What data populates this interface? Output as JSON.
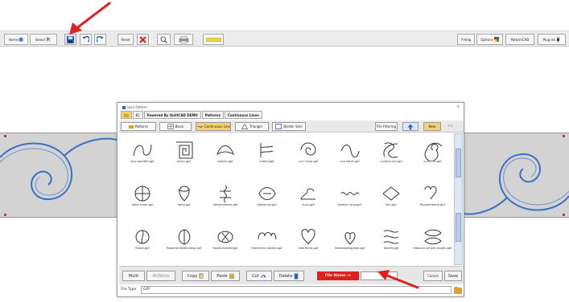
{
  "toolbar": {
    "home_label": "Home",
    "select_label": "Select",
    "reset_label": "Reset",
    "help_label": "Help",
    "options_label": "Options",
    "patterncad_label": "PatternCAD",
    "plugins_label": "Plug-ins"
  },
  "dialog": {
    "title": "Save Pattern",
    "close": "x",
    "crumbs": [
      "C:",
      "Powered By QuiltCAD DEMO",
      "Patterns",
      "Continuous Lines"
    ],
    "tabs": {
      "patterns": "Patterns",
      "block": "Block",
      "continuous_line": "Continuous Line",
      "triangle": "Triangle",
      "border_sets": "Border Sets"
    },
    "filter_label": "File Filtering",
    "new_label": "New",
    "up_label": "Up",
    "help_glyph": "<>",
    "files": [
      "arcs boarder.gpf",
      "aztec.gpf",
      "beanie.gpf",
      "cattail.gpf",
      "curl circle.gpf",
      "curl wave.gpf",
      "curleycurcs.gpf",
      "curlycue.gpf",
      "daisy three.gpf",
      "daisy.gpf",
      "daisylrleaves.gpf",
      "diamonds.gpf",
      "duck.gpf",
      "feather long.gpf",
      "fish.gpf",
      "flippedhearts.gpf",
      "flower.gpf",
      "flowerandleafpleasp.gpf",
      "flowerandleaf.gpf",
      "heartlinks double.gpf",
      "heartlinks.gpf",
      "heartpantograph.gpf",
      "hearts.gpf",
      "hibiscus simple double.gpf"
    ],
    "actions": {
      "multi": "Multi",
      "all_none": "All/None",
      "copy": "Copy",
      "paste": "Paste",
      "cut": "Cut",
      "delete": "Delete",
      "file_name_label": "File Name ->",
      "file_name_value": "",
      "cancel": "Cancel",
      "save": "Save"
    },
    "file_type_label": "File Type",
    "file_type_value": "GPF"
  },
  "colors": {
    "accent_red": "#e02020",
    "active_tab": "#f3d36b",
    "strip": "#d3d3d3",
    "line_blue": "#3a6fc4"
  }
}
